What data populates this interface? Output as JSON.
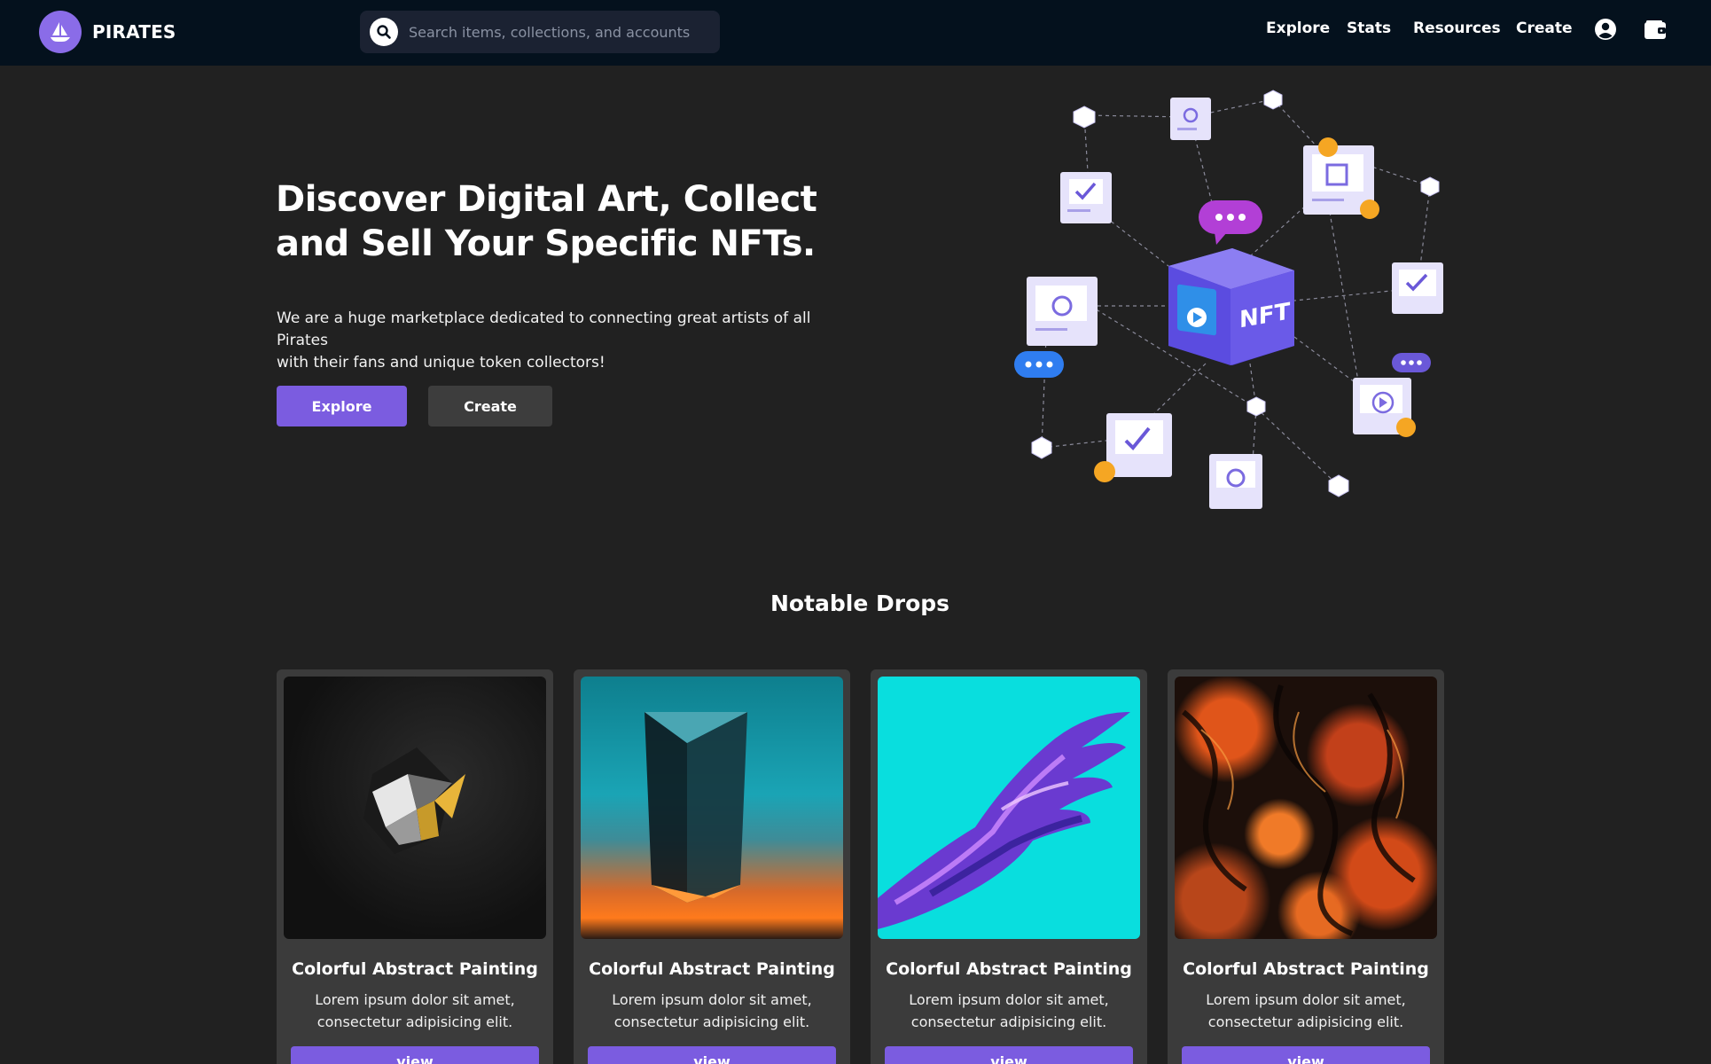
{
  "header": {
    "brand": "PIRATES",
    "search_placeholder": "Search items, collections, and accounts",
    "nav": [
      {
        "label": "Explore"
      },
      {
        "label": "Stats"
      },
      {
        "label": "Resources"
      },
      {
        "label": "Create"
      }
    ],
    "icons": [
      "ship-logo-icon",
      "search-icon",
      "account-icon",
      "wallet-icon"
    ]
  },
  "hero": {
    "title_line1": "Discover Digital Art, Collect",
    "title_line2": "and Sell Your Specific NFTs.",
    "description_line1": "We are a huge marketplace dedicated to connecting great artists of all Pirates",
    "description_line2": "with their fans and unique token collectors!",
    "explore_label": "Explore",
    "create_label": "Create",
    "illustration_label": "NFT"
  },
  "notable_drops": {
    "title": "Notable Drops",
    "cards": [
      {
        "title": "Colorful Abstract Painting",
        "desc_line1": "Lorem ipsum dolor sit amet,",
        "desc_line2": "consectetur adipisicing elit.",
        "button": "view"
      },
      {
        "title": "Colorful Abstract Painting",
        "desc_line1": "Lorem ipsum dolor sit amet,",
        "desc_line2": "consectetur adipisicing elit.",
        "button": "view"
      },
      {
        "title": "Colorful Abstract Painting",
        "desc_line1": "Lorem ipsum dolor sit amet,",
        "desc_line2": "consectetur adipisicing elit.",
        "button": "view"
      },
      {
        "title": "Colorful Abstract Painting",
        "desc_line1": "Lorem ipsum dolor sit amet,",
        "desc_line2": "consectetur adipisicing elit.",
        "button": "view"
      }
    ]
  },
  "colors": {
    "navbar_bg": "#04111d",
    "page_bg": "#212121",
    "accent": "#7b5ce0",
    "secondary_button": "#3d3d3d",
    "card_bg": "#3b3b3b"
  }
}
